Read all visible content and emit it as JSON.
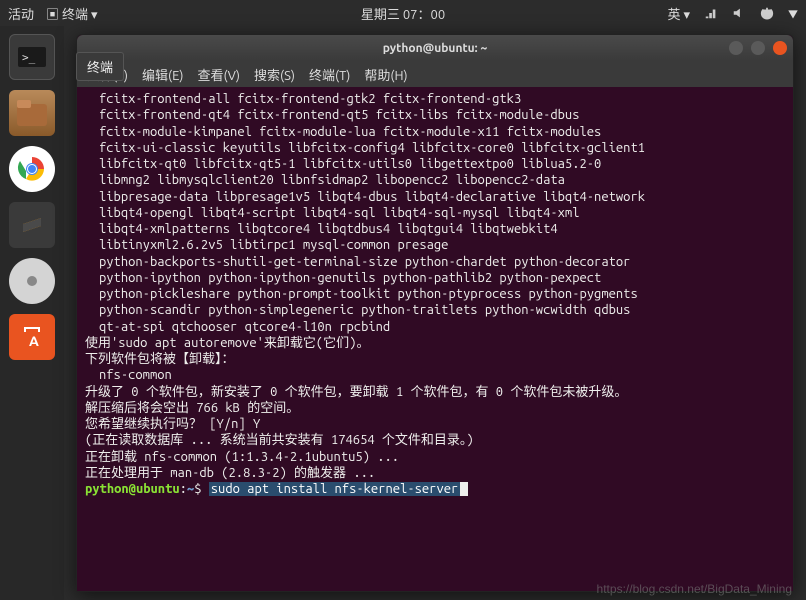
{
  "top_panel": {
    "activities": "活动",
    "app_menu": "终端 ▾",
    "clock": "星期三 07：00",
    "input_method": "英 ▾"
  },
  "sidebar": {
    "tooltip": "终端"
  },
  "window": {
    "title": "python@ubuntu: ~"
  },
  "menubar": {
    "file": "文件(F)",
    "edit": "编辑(E)",
    "view": "查看(V)",
    "search": "搜索(S)",
    "terminal": "终端(T)",
    "help": "帮助(H)"
  },
  "terminal": {
    "lines": [
      "fcitx-frontend-all fcitx-frontend-gtk2 fcitx-frontend-gtk3",
      "fcitx-frontend-qt4 fcitx-frontend-qt5 fcitx-libs fcitx-module-dbus",
      "fcitx-module-kimpanel fcitx-module-lua fcitx-module-x11 fcitx-modules",
      "fcitx-ui-classic keyutils libfcitx-config4 libfcitx-core0 libfcitx-gclient1",
      "libfcitx-qt0 libfcitx-qt5-1 libfcitx-utils0 libgettextpo0 liblua5.2-0",
      "libmng2 libmysqlclient20 libnfsidmap2 libopencc2 libopencc2-data",
      "libpresage-data libpresage1v5 libqt4-dbus libqt4-declarative libqt4-network",
      "libqt4-opengl libqt4-script libqt4-sql libqt4-sql-mysql libqt4-xml",
      "libqt4-xmlpatterns libqtcore4 libqtdbus4 libqtgui4 libqtwebkit4",
      "libtinyxml2.6.2v5 libtirpc1 mysql-common presage",
      "python-backports-shutil-get-terminal-size python-chardet python-decorator",
      "python-ipython python-ipython-genutils python-pathlib2 python-pexpect",
      "python-pickleshare python-prompt-toolkit python-ptyprocess python-pygments",
      "python-scandir python-simplegeneric python-traitlets python-wcwidth qdbus",
      "qt-at-spi qtchooser qtcore4-l10n rpcbind"
    ],
    "msg1": "使用'sudo apt autoremove'来卸载它(它们)。",
    "msg2": "下列软件包将被【卸载】：",
    "pkg_remove": "nfs-common",
    "msg3": "升级了 0 个软件包，新安装了 0 个软件包，要卸载 1 个软件包，有 0 个软件包未被升级。",
    "msg4": "解压缩后将会空出 766 kB 的空间。",
    "msg5": "您希望继续执行吗？ [Y/n] Y",
    "msg6": "(正在读取数据库 ... 系统当前共安装有 174654 个文件和目录。)",
    "msg7": "正在卸载 nfs-common (1:1.3.4-2.1ubuntu5) ...",
    "msg8": "正在处理用于 man-db (2.8.3-2) 的触发器 ...",
    "prompt_user": "python@ubuntu",
    "prompt_sep": ":",
    "prompt_path": "~",
    "prompt_end": "$ ",
    "command": "sudo apt install nfs-kernel-server"
  },
  "watermark": "https://blog.csdn.net/BigData_Mining"
}
